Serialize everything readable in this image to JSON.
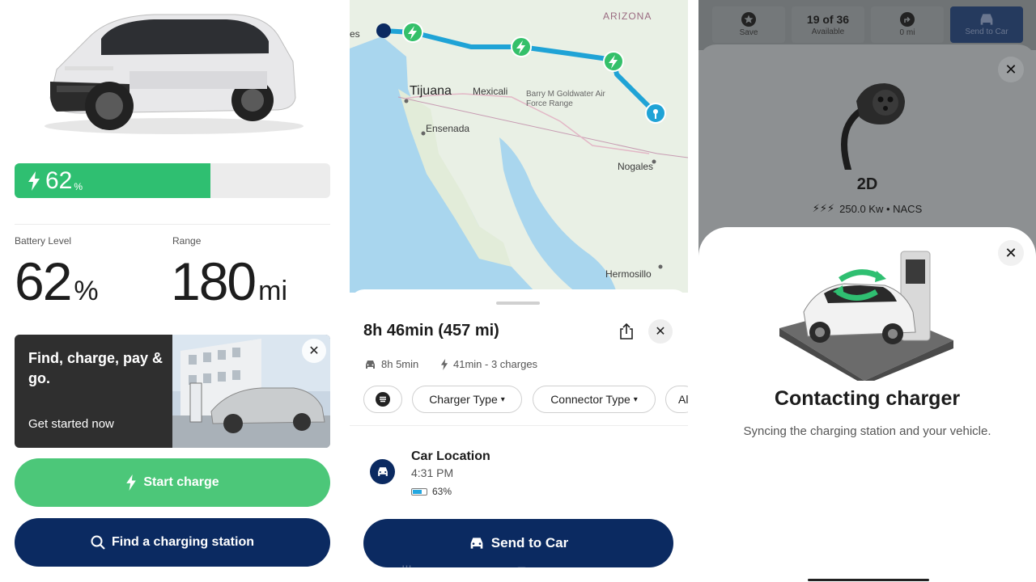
{
  "battery_screen": {
    "battery_percent": 62,
    "battery_bar_value": "62",
    "battery_bar_unit": "%",
    "battery_level_label": "Battery Level",
    "battery_level_value": "62",
    "battery_level_unit": "%",
    "range_label": "Range",
    "range_value": "180",
    "range_unit": "mi",
    "promo": {
      "title": "Find, charge, pay & go.",
      "subtitle": "Get started now",
      "close_icon": "close-icon"
    },
    "start_charge_label": "Start charge",
    "find_station_label": "Find a charging station",
    "colors": {
      "accent_green": "#2fbf71",
      "navy": "#0b2a61"
    }
  },
  "route_screen": {
    "map_labels": {
      "arizona": "ARIZONA",
      "tijuana": "Tijuana",
      "mexicali": "Mexicali",
      "ensenada": "Ensenada",
      "barry": "Barry M Goldwater Air Force Range",
      "nogales": "Nogales",
      "hermosillo": "Hermosillo",
      "partial": "es"
    },
    "route_title": "8h 46min (457 mi)",
    "drive_time": "8h 5min",
    "charge_time": "41min - 3 charges",
    "filters": [
      "Charger Type",
      "Connector Type",
      "Al"
    ],
    "location": {
      "title": "Car Location",
      "time": "4:31 PM",
      "battery": "63%",
      "battery_percent": 63
    },
    "send_label": "Send to Car",
    "colors": {
      "route": "#1fa3d6",
      "charger_pin": "#34c06a"
    }
  },
  "charger_screen": {
    "topbar": {
      "save": "Save",
      "available_count": "19 of 36",
      "available_label": "Available",
      "distance": "0 mi",
      "send_to_car": "Send to Car"
    },
    "charger_name": "2D",
    "charger_spec": "250.0 Kw • NACS",
    "contact_title": "Contacting charger",
    "contact_subtitle": "Syncing the charging station and your vehicle."
  }
}
